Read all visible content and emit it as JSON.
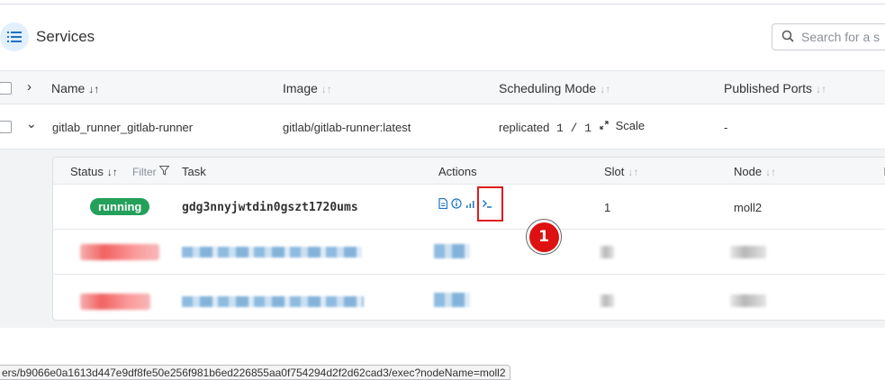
{
  "header": {
    "title": "Services",
    "search_placeholder": "Search for a s"
  },
  "table": {
    "columns": [
      {
        "label": "Name",
        "sort": "↓↑"
      },
      {
        "label": "Image",
        "sort": "↓↑"
      },
      {
        "label": "Scheduling Mode",
        "sort": "↓↑"
      },
      {
        "label": "Published Ports",
        "sort": "↓↑"
      }
    ],
    "service_row": {
      "expand_glyph": "⌄",
      "name": "gitlab_runner_gitlab-runner",
      "image": "gitlab/gitlab-runner:latest",
      "mode": "replicated",
      "replicas": "1 / 1",
      "scale_label": "Scale",
      "ports": "-"
    }
  },
  "tasks": {
    "columns": {
      "status": "Status",
      "filter": "Filter",
      "task": "Task",
      "actions": "Actions",
      "slot": "Slot",
      "node": "Node"
    },
    "sort_glyph": "↓↑",
    "rows": [
      {
        "status": "running",
        "task": "gdg3nnyjwtdin0gszt1720ums",
        "slot": "1",
        "node": "moll2"
      }
    ]
  },
  "annotation": {
    "marker_number": "1",
    "highlight_color": "#e01a1a"
  },
  "status_bar": {
    "url": "ers/b9066e0a1613d447e9df8fe50e256f981b6ed226855aa0f754294d2f2d62cad3/exec?nodeName=moll2"
  },
  "colors": {
    "accent": "#1a73c5",
    "running": "#23a05a",
    "icon_bg": "#e1efff"
  }
}
